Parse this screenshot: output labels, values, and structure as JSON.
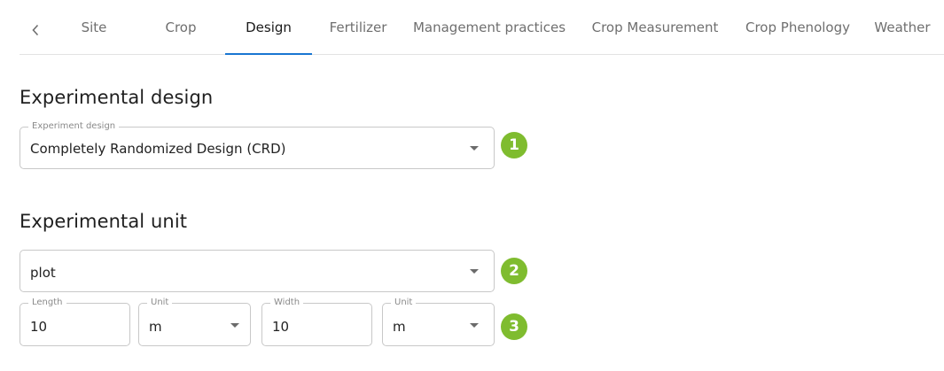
{
  "tabs": {
    "items": [
      {
        "label": "Site"
      },
      {
        "label": "Crop"
      },
      {
        "label": "Design"
      },
      {
        "label": "Fertilizer"
      },
      {
        "label": "Management practices"
      },
      {
        "label": "Crop Measurement"
      },
      {
        "label": "Crop Phenology"
      },
      {
        "label": "Weather"
      }
    ],
    "active": "Design",
    "prev_icon": "chevron-left-icon"
  },
  "experimental_design": {
    "heading": "Experimental design",
    "field_label": "Experiment design",
    "value": "Completely Randomized Design (CRD)",
    "badge": "1"
  },
  "experimental_unit": {
    "heading": "Experimental unit",
    "unit_type": {
      "value": "plot"
    },
    "badge_unit": "2",
    "length": {
      "label": "Length",
      "value": "10"
    },
    "length_unit": {
      "label": "Unit",
      "value": "m"
    },
    "width": {
      "label": "Width",
      "value": "10"
    },
    "width_unit": {
      "label": "Unit",
      "value": "m"
    },
    "badge_dims": "3"
  },
  "colors": {
    "accent": "#1976d2",
    "badge": "#7fbc2f"
  }
}
